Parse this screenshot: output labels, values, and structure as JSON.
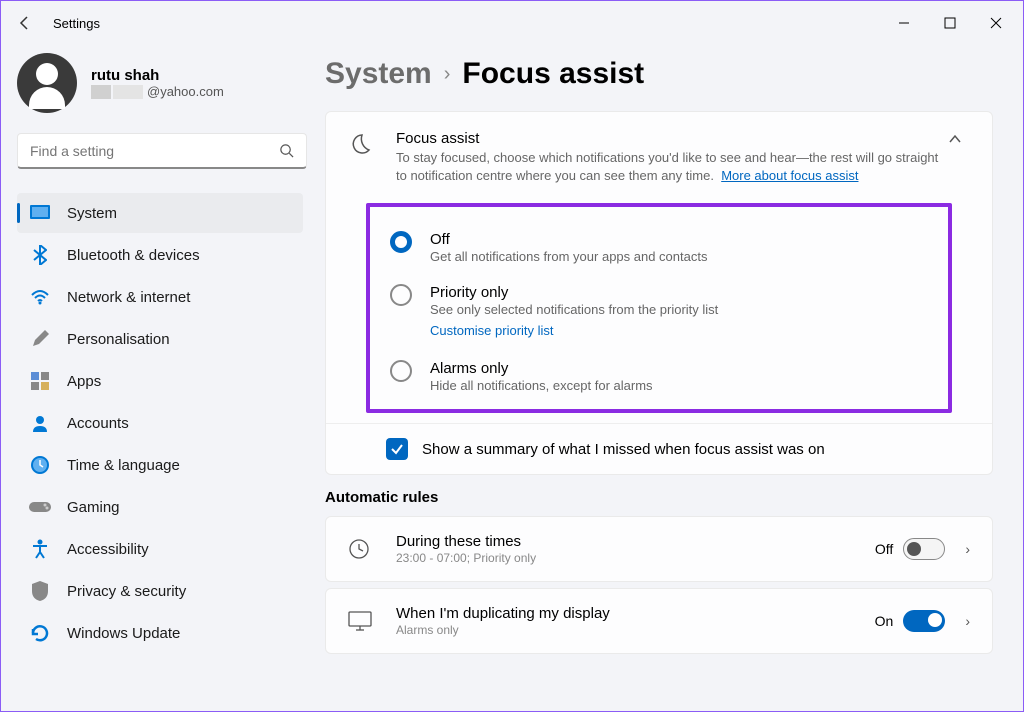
{
  "app_title": "Settings",
  "profile": {
    "name": "rutu shah",
    "email_domain": "@yahoo.com"
  },
  "search": {
    "placeholder": "Find a setting"
  },
  "nav": [
    {
      "label": "System"
    },
    {
      "label": "Bluetooth & devices"
    },
    {
      "label": "Network & internet"
    },
    {
      "label": "Personalisation"
    },
    {
      "label": "Apps"
    },
    {
      "label": "Accounts"
    },
    {
      "label": "Time & language"
    },
    {
      "label": "Gaming"
    },
    {
      "label": "Accessibility"
    },
    {
      "label": "Privacy & security"
    },
    {
      "label": "Windows Update"
    }
  ],
  "breadcrumb": {
    "parent": "System",
    "current": "Focus assist"
  },
  "focus_card": {
    "title": "Focus assist",
    "desc": "To stay focused, choose which notifications you'd like to see and hear—the rest will go straight to notification centre where you can see them any time.",
    "link": "More about focus assist"
  },
  "options": {
    "off": {
      "label": "Off",
      "sub": "Get all notifications from your apps and contacts"
    },
    "priority": {
      "label": "Priority only",
      "sub": "See only selected notifications from the priority list",
      "link": "Customise priority list"
    },
    "alarms": {
      "label": "Alarms only",
      "sub": "Hide all notifications, except for alarms"
    }
  },
  "summary": {
    "text": "Show a summary of what I missed when focus assist was on"
  },
  "auto_rules_title": "Automatic rules",
  "rules": {
    "times": {
      "title": "During these times",
      "sub": "23:00 - 07:00; Priority only",
      "state": "Off"
    },
    "duplicating": {
      "title": "When I'm duplicating my display",
      "sub": "Alarms only",
      "state": "On"
    }
  }
}
